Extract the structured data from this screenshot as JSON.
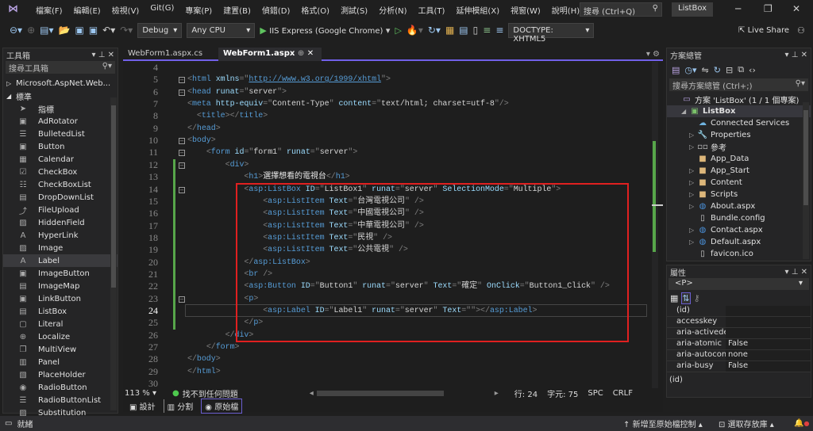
{
  "menubar": {
    "items": [
      "檔案(F)",
      "編輯(E)",
      "檢視(V)",
      "Git(G)",
      "專案(P)",
      "建置(B)",
      "偵錯(D)",
      "格式(O)",
      "測試(S)",
      "分析(N)",
      "工具(T)",
      "延伸模組(X)",
      "視窗(W)",
      "說明(H)"
    ],
    "search": "搜尋 (Ctrl+Q)",
    "project": "ListBox"
  },
  "toolbar": {
    "config": "Debug",
    "platform": "Any CPU",
    "run": "IIS Express (Google Chrome)",
    "doctype": "DOCTYPE: XHTML5",
    "live_share": "Live Share"
  },
  "toolbox": {
    "title": "工具箱",
    "search": "搜尋工具箱",
    "group_collapsed": "Microsoft.AspNet.Web...",
    "group": "標準",
    "items": [
      {
        "label": "指標",
        "icon": "pointer-icon"
      },
      {
        "label": "AdRotator",
        "icon": "adrotator-icon"
      },
      {
        "label": "BulletedList",
        "icon": "list-icon"
      },
      {
        "label": "Button",
        "icon": "button-icon"
      },
      {
        "label": "Calendar",
        "icon": "calendar-icon"
      },
      {
        "label": "CheckBox",
        "icon": "checkbox-icon"
      },
      {
        "label": "CheckBoxList",
        "icon": "checkboxlist-icon"
      },
      {
        "label": "DropDownList",
        "icon": "dropdown-icon"
      },
      {
        "label": "FileUpload",
        "icon": "upload-icon"
      },
      {
        "label": "HiddenField",
        "icon": "hidden-icon"
      },
      {
        "label": "HyperLink",
        "icon": "hyperlink-icon"
      },
      {
        "label": "Image",
        "icon": "image-icon"
      },
      {
        "label": "Label",
        "icon": "label-icon",
        "selected": true
      },
      {
        "label": "ImageButton",
        "icon": "imagebutton-icon"
      },
      {
        "label": "ImageMap",
        "icon": "imagemap-icon"
      },
      {
        "label": "LinkButton",
        "icon": "linkbutton-icon"
      },
      {
        "label": "ListBox",
        "icon": "listbox-icon"
      },
      {
        "label": "Literal",
        "icon": "literal-icon"
      },
      {
        "label": "Localize",
        "icon": "localize-icon"
      },
      {
        "label": "MultiView",
        "icon": "multiview-icon"
      },
      {
        "label": "Panel",
        "icon": "panel-icon"
      },
      {
        "label": "PlaceHolder",
        "icon": "placeholder-icon"
      },
      {
        "label": "RadioButton",
        "icon": "radio-icon"
      },
      {
        "label": "RadioButtonList",
        "icon": "radiolist-icon"
      },
      {
        "label": "Substitution",
        "icon": "substitution-icon"
      }
    ]
  },
  "editor": {
    "tabs": [
      {
        "label": "WebForm1.aspx.cs",
        "active": false
      },
      {
        "label": "WebForm1.aspx",
        "active": true
      }
    ],
    "current_line": 24,
    "lines": [
      {
        "n": 4,
        "tokens": []
      },
      {
        "n": 5,
        "tokens": [
          [
            "d",
            "<"
          ],
          [
            "t",
            "html"
          ],
          [
            "a",
            " xmlns"
          ],
          [
            "d",
            "=\""
          ],
          [
            "u",
            "http://www.w3.org/1999/xhtml"
          ],
          [
            "d",
            "\">"
          ]
        ]
      },
      {
        "n": 6,
        "tokens": [
          [
            "d",
            "<"
          ],
          [
            "t",
            "head"
          ],
          [
            "a",
            " runat"
          ],
          [
            "d",
            "=\""
          ],
          [
            "v",
            "server"
          ],
          [
            "d",
            "\">"
          ]
        ]
      },
      {
        "n": 7,
        "tokens": [
          [
            "d",
            "<"
          ],
          [
            "t",
            "meta"
          ],
          [
            "a",
            " http-equiv"
          ],
          [
            "d",
            "=\""
          ],
          [
            "v",
            "Content-Type"
          ],
          [
            "d",
            "\""
          ],
          [
            "a",
            " content"
          ],
          [
            "d",
            "=\""
          ],
          [
            "v",
            "text/html; charset=utf-8"
          ],
          [
            "d",
            "\"/>"
          ]
        ]
      },
      {
        "n": 8,
        "tokens": [
          [
            "x",
            "  "
          ],
          [
            "d",
            "<"
          ],
          [
            "t",
            "title"
          ],
          [
            "d",
            "></"
          ],
          [
            "t",
            "title"
          ],
          [
            "d",
            ">"
          ]
        ]
      },
      {
        "n": 9,
        "tokens": [
          [
            "d",
            "</"
          ],
          [
            "t",
            "head"
          ],
          [
            "d",
            ">"
          ]
        ]
      },
      {
        "n": 10,
        "tokens": [
          [
            "d",
            "<"
          ],
          [
            "t",
            "body"
          ],
          [
            "d",
            ">"
          ]
        ]
      },
      {
        "n": 11,
        "tokens": [
          [
            "x",
            "    "
          ],
          [
            "d",
            "<"
          ],
          [
            "t",
            "form"
          ],
          [
            "a",
            " id"
          ],
          [
            "d",
            "=\""
          ],
          [
            "v",
            "form1"
          ],
          [
            "d",
            "\""
          ],
          [
            "a",
            " runat"
          ],
          [
            "d",
            "=\""
          ],
          [
            "v",
            "server"
          ],
          [
            "d",
            "\">"
          ]
        ]
      },
      {
        "n": 12,
        "tokens": [
          [
            "x",
            "        "
          ],
          [
            "d",
            "<"
          ],
          [
            "t",
            "div"
          ],
          [
            "d",
            ">"
          ]
        ]
      },
      {
        "n": 13,
        "tokens": [
          [
            "x",
            "            "
          ],
          [
            "d",
            "<"
          ],
          [
            "t",
            "h1"
          ],
          [
            "d",
            ">"
          ],
          [
            "x",
            "選擇想看的電視台"
          ],
          [
            "d",
            "</"
          ],
          [
            "t",
            "h1"
          ],
          [
            "d",
            ">"
          ]
        ]
      },
      {
        "n": 14,
        "tokens": [
          [
            "x",
            "            "
          ],
          [
            "d",
            "<"
          ],
          [
            "t",
            "asp:ListBox"
          ],
          [
            "a",
            " ID"
          ],
          [
            "d",
            "=\""
          ],
          [
            "v",
            "ListBox1"
          ],
          [
            "d",
            "\""
          ],
          [
            "a",
            " runat"
          ],
          [
            "d",
            "=\""
          ],
          [
            "v",
            "server"
          ],
          [
            "d",
            "\""
          ],
          [
            "a",
            " SelectionMode"
          ],
          [
            "d",
            "=\""
          ],
          [
            "v",
            "Multiple"
          ],
          [
            "d",
            "\">"
          ]
        ]
      },
      {
        "n": 15,
        "tokens": [
          [
            "x",
            "                "
          ],
          [
            "d",
            "<"
          ],
          [
            "t",
            "asp:ListItem"
          ],
          [
            "a",
            " Text"
          ],
          [
            "d",
            "=\""
          ],
          [
            "v",
            "台灣電視公司"
          ],
          [
            "d",
            "\" />"
          ]
        ]
      },
      {
        "n": 16,
        "tokens": [
          [
            "x",
            "                "
          ],
          [
            "d",
            "<"
          ],
          [
            "t",
            "asp:ListItem"
          ],
          [
            "a",
            " Text"
          ],
          [
            "d",
            "=\""
          ],
          [
            "v",
            "中國電視公司"
          ],
          [
            "d",
            "\" />"
          ]
        ]
      },
      {
        "n": 17,
        "tokens": [
          [
            "x",
            "                "
          ],
          [
            "d",
            "<"
          ],
          [
            "t",
            "asp:ListItem"
          ],
          [
            "a",
            " Text"
          ],
          [
            "d",
            "=\""
          ],
          [
            "v",
            "中華電視公司"
          ],
          [
            "d",
            "\" />"
          ]
        ]
      },
      {
        "n": 18,
        "tokens": [
          [
            "x",
            "                "
          ],
          [
            "d",
            "<"
          ],
          [
            "t",
            "asp:ListItem"
          ],
          [
            "a",
            " Text"
          ],
          [
            "d",
            "=\""
          ],
          [
            "v",
            "民視"
          ],
          [
            "d",
            "\" />"
          ]
        ]
      },
      {
        "n": 19,
        "tokens": [
          [
            "x",
            "                "
          ],
          [
            "d",
            "<"
          ],
          [
            "t",
            "asp:ListItem"
          ],
          [
            "a",
            " Text"
          ],
          [
            "d",
            "=\""
          ],
          [
            "v",
            "公共電視"
          ],
          [
            "d",
            "\" />"
          ]
        ]
      },
      {
        "n": 20,
        "tokens": [
          [
            "x",
            "            "
          ],
          [
            "d",
            "</"
          ],
          [
            "t",
            "asp:ListBox"
          ],
          [
            "d",
            ">"
          ]
        ]
      },
      {
        "n": 21,
        "tokens": [
          [
            "x",
            "            "
          ],
          [
            "d",
            "<"
          ],
          [
            "t",
            "br"
          ],
          [
            "d",
            " />"
          ]
        ]
      },
      {
        "n": 22,
        "tokens": [
          [
            "x",
            "            "
          ],
          [
            "d",
            "<"
          ],
          [
            "t",
            "asp:Button"
          ],
          [
            "a",
            " ID"
          ],
          [
            "d",
            "=\""
          ],
          [
            "v",
            "Button1"
          ],
          [
            "d",
            "\""
          ],
          [
            "a",
            " runat"
          ],
          [
            "d",
            "=\""
          ],
          [
            "v",
            "server"
          ],
          [
            "d",
            "\""
          ],
          [
            "a",
            " Text"
          ],
          [
            "d",
            "=\""
          ],
          [
            "v",
            "確定"
          ],
          [
            "d",
            "\""
          ],
          [
            "a",
            " OnClick"
          ],
          [
            "d",
            "=\""
          ],
          [
            "v",
            "Button1_Click"
          ],
          [
            "d",
            "\" />"
          ]
        ]
      },
      {
        "n": 23,
        "tokens": [
          [
            "x",
            "            "
          ],
          [
            "d",
            "<"
          ],
          [
            "t",
            "p"
          ],
          [
            "d",
            ">"
          ]
        ]
      },
      {
        "n": 24,
        "tokens": [
          [
            "x",
            "                "
          ],
          [
            "d",
            "<"
          ],
          [
            "t",
            "asp:Label"
          ],
          [
            "a",
            " ID"
          ],
          [
            "d",
            "=\""
          ],
          [
            "v",
            "Label1"
          ],
          [
            "d",
            "\""
          ],
          [
            "a",
            " runat"
          ],
          [
            "d",
            "=\""
          ],
          [
            "v",
            "server"
          ],
          [
            "d",
            "\""
          ],
          [
            "a",
            " Text"
          ],
          [
            "d",
            "=\"\""
          ],
          [
            "d",
            "></"
          ],
          [
            "t",
            "asp:Label"
          ],
          [
            "d",
            ">"
          ]
        ]
      },
      {
        "n": 25,
        "tokens": [
          [
            "x",
            "            "
          ],
          [
            "d",
            "</"
          ],
          [
            "t",
            "p"
          ],
          [
            "d",
            ">"
          ]
        ]
      },
      {
        "n": 26,
        "tokens": [
          [
            "x",
            "        "
          ],
          [
            "d",
            "</"
          ],
          [
            "t",
            "div"
          ],
          [
            "d",
            ">"
          ]
        ]
      },
      {
        "n": 27,
        "tokens": [
          [
            "x",
            "    "
          ],
          [
            "d",
            "</"
          ],
          [
            "t",
            "form"
          ],
          [
            "d",
            ">"
          ]
        ]
      },
      {
        "n": 28,
        "tokens": [
          [
            "d",
            "</"
          ],
          [
            "t",
            "body"
          ],
          [
            "d",
            ">"
          ]
        ]
      },
      {
        "n": 29,
        "tokens": [
          [
            "d",
            "</"
          ],
          [
            "t",
            "html"
          ],
          [
            "d",
            ">"
          ]
        ]
      },
      {
        "n": 30,
        "tokens": []
      }
    ],
    "status": {
      "zoom": "113 %",
      "issues": "找不到任何問題",
      "line": "行: 24",
      "col": "字元: 75",
      "spc": "SPC",
      "crlf": "CRLF"
    },
    "view_tabs": [
      {
        "label": "設計"
      },
      {
        "label": "分割"
      },
      {
        "label": "原始檔",
        "active": true
      }
    ]
  },
  "solution": {
    "title": "方案總管",
    "search": "搜尋方案總管 (Ctrl+;)",
    "items": [
      {
        "label": "方案 'ListBox' (1 / 1 個專案)",
        "icon": "solution-icon",
        "level": 0,
        "exp": ""
      },
      {
        "label": "ListBox",
        "icon": "project-icon",
        "level": 1,
        "exp": "◢",
        "bold": true
      },
      {
        "label": "Connected Services",
        "icon": "cloud-icon",
        "level": 2,
        "exp": ""
      },
      {
        "label": "Properties",
        "icon": "wrench-icon",
        "level": 2,
        "exp": "▷"
      },
      {
        "label": "參考",
        "icon": "references-icon",
        "level": 2,
        "exp": "▷"
      },
      {
        "label": "App_Data",
        "icon": "folder-icon",
        "level": 2,
        "exp": ""
      },
      {
        "label": "App_Start",
        "icon": "folder-icon",
        "level": 2,
        "exp": "▷"
      },
      {
        "label": "Content",
        "icon": "folder-icon",
        "level": 2,
        "exp": "▷"
      },
      {
        "label": "Scripts",
        "icon": "folder-icon",
        "level": 2,
        "exp": "▷"
      },
      {
        "label": "About.aspx",
        "icon": "aspx-file-icon",
        "level": 2,
        "exp": "▷"
      },
      {
        "label": "Bundle.config",
        "icon": "config-file-icon",
        "level": 2,
        "exp": ""
      },
      {
        "label": "Contact.aspx",
        "icon": "aspx-file-icon",
        "level": 2,
        "exp": "▷"
      },
      {
        "label": "Default.aspx",
        "icon": "aspx-file-icon",
        "level": 2,
        "exp": "▷"
      },
      {
        "label": "favicon.ico",
        "icon": "ico-file-icon",
        "level": 2,
        "exp": ""
      }
    ]
  },
  "properties": {
    "title": "屬性",
    "object": "<P>",
    "rows": [
      {
        "k": "(id)",
        "v": ""
      },
      {
        "k": "accesskey",
        "v": ""
      },
      {
        "k": "aria-activedesce",
        "v": ""
      },
      {
        "k": "aria-atomic",
        "v": "False"
      },
      {
        "k": "aria-autocompl",
        "v": "none"
      },
      {
        "k": "aria-busy",
        "v": "False"
      }
    ],
    "description": "(id)"
  },
  "statusbar": {
    "ready": "就緒",
    "source_control": "新增至原始檔控制",
    "repo": "選取存放庫"
  },
  "colors": {
    "accent": "#7160e8",
    "highlight_box": "#e02020",
    "change_bar": "#57a64a"
  }
}
